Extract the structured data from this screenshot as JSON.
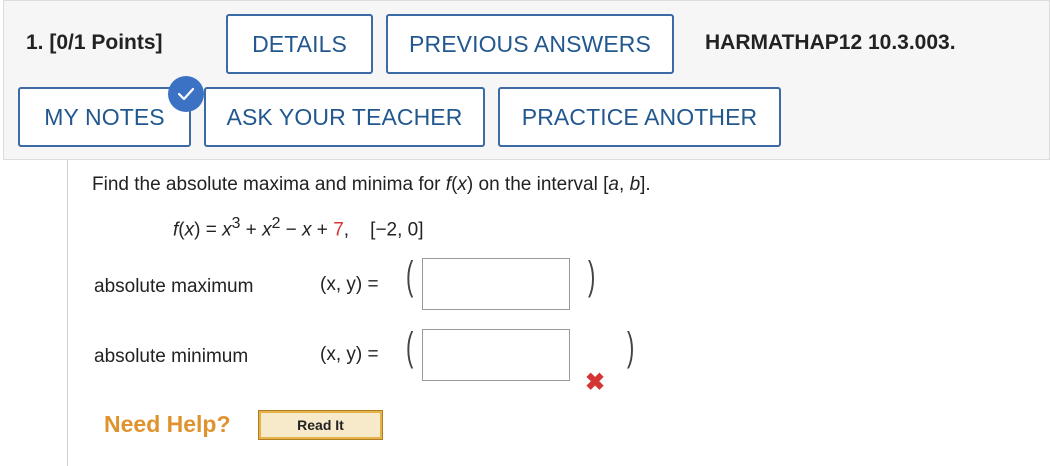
{
  "question": {
    "number_points": "1. [0/1 Points]",
    "code": "HARMATHAP12 10.3.003."
  },
  "buttons": {
    "details": "DETAILS",
    "previous_answers": "PREVIOUS ANSWERS",
    "my_notes": "MY NOTES",
    "ask_teacher": "ASK YOUR TEACHER",
    "practice_another": "PRACTICE ANOTHER"
  },
  "problem": {
    "prompt_parts": [
      "Find the absolute maxima and minima for ",
      "f",
      "(",
      "x",
      ") on the interval [",
      "a",
      ", ",
      "b",
      "]."
    ],
    "formula_parts": {
      "f": "f",
      "open": "(",
      "x": "x",
      "close": ") = ",
      "x3": "x",
      "exp3": "3",
      "plus1": " + ",
      "x2": "x",
      "exp2": "2",
      "minus": " − ",
      "x1": "x",
      "plus2": " + ",
      "constant": "7",
      "comma": ",",
      "interval": "[−2, 0]"
    }
  },
  "rows": [
    {
      "label": "absolute maximum",
      "xy": "(x, y) =",
      "value": ""
    },
    {
      "label": "absolute minimum",
      "xy": "(x, y) =",
      "value": ""
    }
  ],
  "help": {
    "need_help": "Need Help?",
    "read_it": "Read It"
  },
  "colors": {
    "button_text": "#23588f",
    "error": "#d63535",
    "help": "#e0922f",
    "check": "#3c72c4"
  },
  "icons": {
    "check": "check-icon",
    "incorrect": "x-mark-icon"
  }
}
